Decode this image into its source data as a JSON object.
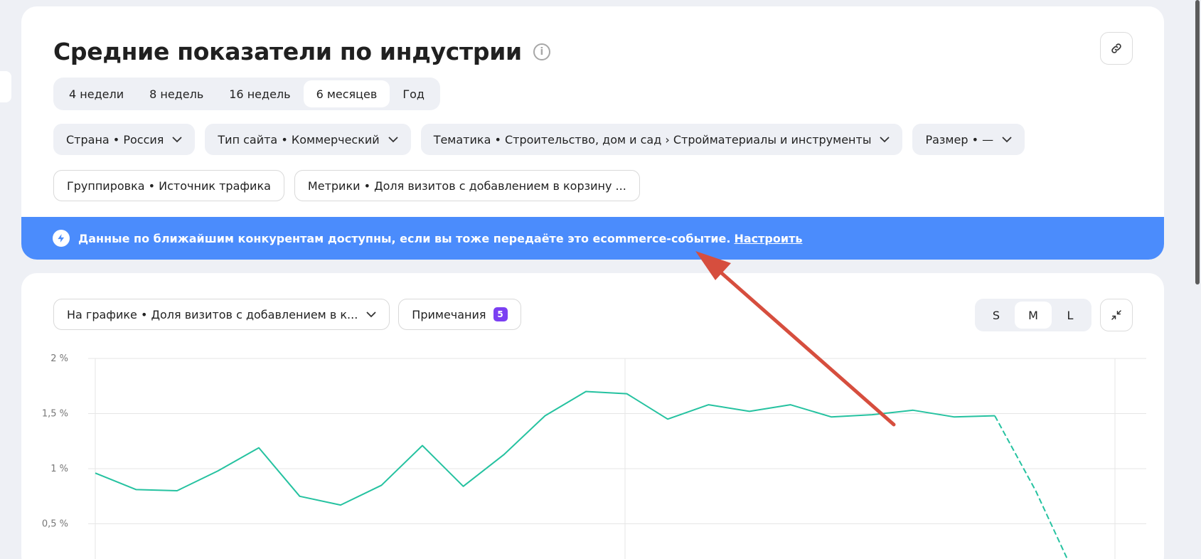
{
  "header": {
    "title": "Средние показатели по индустрии",
    "info_icon": "info-icon",
    "link_icon": "link-icon"
  },
  "periods": [
    {
      "label": "4 недели",
      "active": false
    },
    {
      "label": "8 недель",
      "active": false
    },
    {
      "label": "16 недель",
      "active": false
    },
    {
      "label": "6 месяцев",
      "active": true
    },
    {
      "label": "Год",
      "active": false
    }
  ],
  "filters": {
    "country": "Страна • Россия",
    "site_type": "Тип сайта • Коммерческий",
    "topic": "Тематика • Строительство, дом и сад › Стройматериалы и инструменты",
    "size": "Размер • —",
    "grouping": "Группировка • Источник трафика",
    "metrics": "Метрики • Доля визитов с добавлением в корзину ..."
  },
  "banner": {
    "text": "Данные по ближайшим конкурентам доступны, если вы тоже передаёте это ecommerce-событие.",
    "link": "Настроить",
    "icon": "bolt-icon"
  },
  "chart_controls": {
    "on_chart": "На графике • Доля визитов с добавлением в к...",
    "notes_label": "Примечания",
    "notes_count": "5",
    "sizes": [
      {
        "label": "S",
        "active": false
      },
      {
        "label": "M",
        "active": true
      },
      {
        "label": "L",
        "active": false
      }
    ],
    "collapse_icon": "collapse-icon"
  },
  "colors": {
    "accent": "#4b8cfc",
    "series": "#25c2a0",
    "arrow": "#d64e3e",
    "badge": "#7b3ff2"
  },
  "chart_data": {
    "type": "line",
    "ylim": [
      0,
      2
    ],
    "yticks": [
      "2 %",
      "1,5 %",
      "1 %",
      "0,5 %"
    ],
    "ytick_values": [
      2,
      1.5,
      1,
      0.5
    ],
    "x": [
      1,
      2,
      3,
      4,
      5,
      6,
      7,
      8,
      9,
      10,
      11,
      12,
      13,
      14,
      15,
      16,
      17,
      18,
      19,
      20,
      21,
      22,
      23,
      24,
      25
    ],
    "series": [
      {
        "values": [
          0.96,
          0.81,
          0.8,
          0.98,
          1.19,
          0.75,
          0.67,
          0.85,
          1.21,
          0.84,
          1.13,
          1.48,
          1.7,
          1.68,
          1.45,
          1.58,
          1.52,
          1.58,
          1.47,
          1.49,
          1.53,
          1.47,
          1.48,
          0.8,
          0.0
        ]
      }
    ],
    "dashed_from_index": 23,
    "grid": true
  }
}
